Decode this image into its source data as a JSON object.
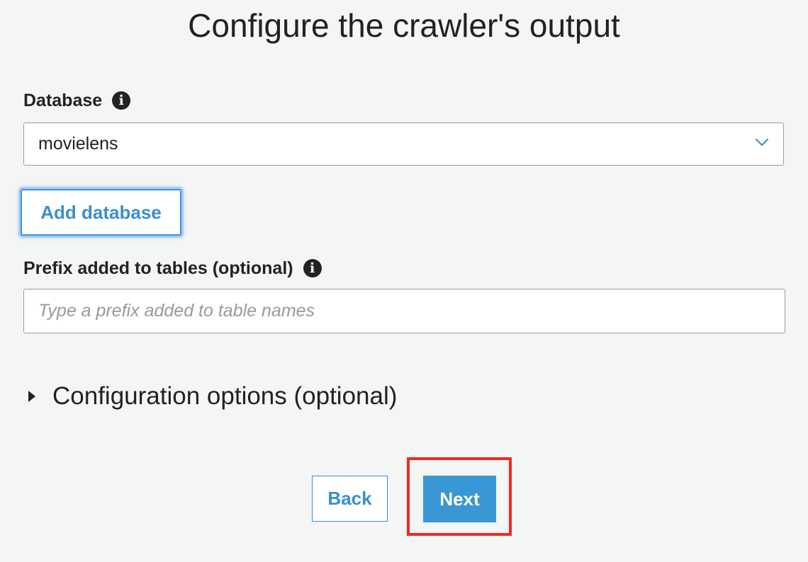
{
  "page": {
    "title": "Configure the crawler's output"
  },
  "database": {
    "label": "Database",
    "info_icon": "info-icon",
    "selected_value": "movielens",
    "add_button_label": "Add database"
  },
  "prefix": {
    "label": "Prefix added to tables (optional)",
    "info_icon": "info-icon",
    "value": "",
    "placeholder": "Type a prefix added to table names"
  },
  "config_options": {
    "label": "Configuration options (optional)",
    "expanded": false
  },
  "footer": {
    "back_label": "Back",
    "next_label": "Next"
  },
  "colors": {
    "accent": "#3a97d6",
    "link_text": "#3a8fd0",
    "highlight": "#ee2b22",
    "background": "#f4f5f5"
  }
}
